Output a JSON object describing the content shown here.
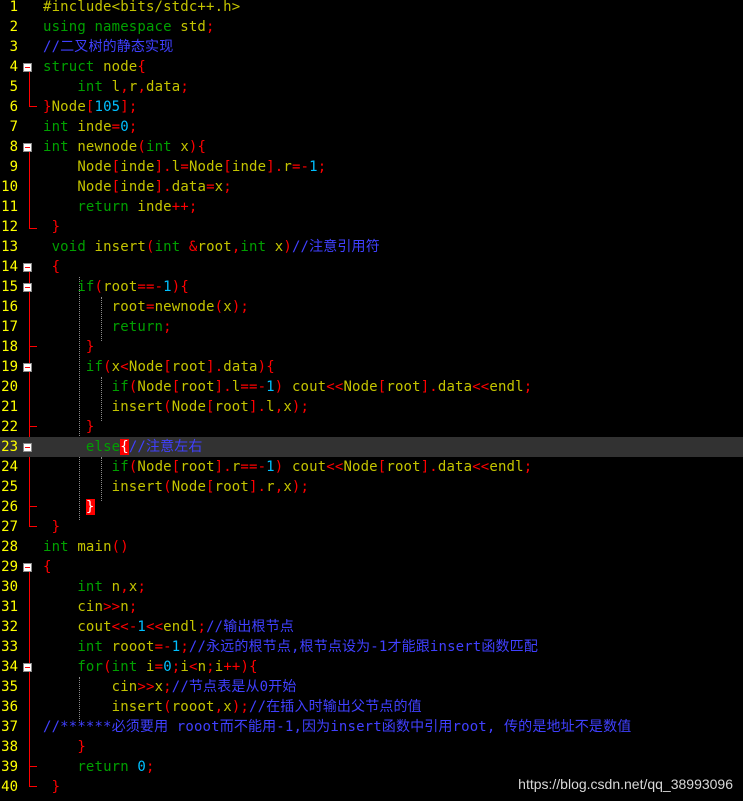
{
  "editor": {
    "current_line": 23,
    "lines": [
      {
        "n": "1",
        "tokens": [
          [
            "#include<bits/stdc++.h>",
            "#c4c400"
          ]
        ]
      },
      {
        "n": "2",
        "tokens": [
          [
            "using namespace ",
            "#00a000"
          ],
          [
            "std",
            "#c4c400"
          ],
          [
            ";",
            "#ff0000"
          ]
        ]
      },
      {
        "n": "3",
        "tokens": [
          [
            "//二叉树的静态实现",
            "#4040ff"
          ]
        ]
      },
      {
        "n": "4",
        "fold": true,
        "tokens": [
          [
            "struct ",
            "#00a000"
          ],
          [
            "node",
            "#c4c400"
          ],
          [
            "{",
            "#ff0000"
          ]
        ]
      },
      {
        "n": "5",
        "tokens": [
          [
            "    ",
            "#ffffff"
          ],
          [
            "int ",
            "#00a000"
          ],
          [
            "l",
            "#c4c400"
          ],
          [
            ",",
            "#ff0000"
          ],
          [
            "r",
            "#c4c400"
          ],
          [
            ",",
            "#ff0000"
          ],
          [
            "data",
            "#c4c400"
          ],
          [
            ";",
            "#ff0000"
          ]
        ]
      },
      {
        "n": "6",
        "tokens": [
          [
            "}",
            "#ff0000"
          ],
          [
            "Node",
            "#c4c400"
          ],
          [
            "[",
            "#ff0000"
          ],
          [
            "105",
            "#00c0ff"
          ],
          [
            "];",
            "#ff0000"
          ]
        ]
      },
      {
        "n": "7",
        "tokens": [
          [
            "int ",
            "#00a000"
          ],
          [
            "inde",
            "#c4c400"
          ],
          [
            "=",
            "#ff0000"
          ],
          [
            "0",
            "#00c0ff"
          ],
          [
            ";",
            "#ff0000"
          ]
        ]
      },
      {
        "n": "8",
        "fold": true,
        "tokens": [
          [
            "int ",
            "#00a000"
          ],
          [
            "newnode",
            "#c4c400"
          ],
          [
            "(",
            "#ff0000"
          ],
          [
            "int ",
            "#00a000"
          ],
          [
            "x",
            "#c4c400"
          ],
          [
            "){",
            "#ff0000"
          ]
        ]
      },
      {
        "n": "9",
        "tokens": [
          [
            "    ",
            "#ffffff"
          ],
          [
            "Node",
            "#c4c400"
          ],
          [
            "[",
            "#ff0000"
          ],
          [
            "inde",
            "#c4c400"
          ],
          [
            "].",
            "#ff0000"
          ],
          [
            "l",
            "#c4c400"
          ],
          [
            "=",
            "#ff0000"
          ],
          [
            "Node",
            "#c4c400"
          ],
          [
            "[",
            "#ff0000"
          ],
          [
            "inde",
            "#c4c400"
          ],
          [
            "].",
            "#ff0000"
          ],
          [
            "r",
            "#c4c400"
          ],
          [
            "=-",
            "#ff0000"
          ],
          [
            "1",
            "#00c0ff"
          ],
          [
            ";",
            "#ff0000"
          ]
        ]
      },
      {
        "n": "10",
        "tokens": [
          [
            "    ",
            "#ffffff"
          ],
          [
            "Node",
            "#c4c400"
          ],
          [
            "[",
            "#ff0000"
          ],
          [
            "inde",
            "#c4c400"
          ],
          [
            "].",
            "#ff0000"
          ],
          [
            "data",
            "#c4c400"
          ],
          [
            "=",
            "#ff0000"
          ],
          [
            "x",
            "#c4c400"
          ],
          [
            ";",
            "#ff0000"
          ]
        ]
      },
      {
        "n": "11",
        "tokens": [
          [
            "    ",
            "#ffffff"
          ],
          [
            "return ",
            "#00a000"
          ],
          [
            "inde",
            "#c4c400"
          ],
          [
            "++;",
            "#ff0000"
          ]
        ]
      },
      {
        "n": "12",
        "tokens": [
          [
            " }",
            "#ff0000"
          ]
        ]
      },
      {
        "n": "13",
        "tokens": [
          [
            " ",
            "#ffffff"
          ],
          [
            "void ",
            "#00a000"
          ],
          [
            "insert",
            "#c4c400"
          ],
          [
            "(",
            "#ff0000"
          ],
          [
            "int ",
            "#00a000"
          ],
          [
            "&",
            "#ff0000"
          ],
          [
            "root",
            "#c4c400"
          ],
          [
            ",",
            "#ff0000"
          ],
          [
            "int ",
            "#00a000"
          ],
          [
            "x",
            "#c4c400"
          ],
          [
            ")",
            "#ff0000"
          ],
          [
            "//注意引用符",
            "#4040ff"
          ]
        ]
      },
      {
        "n": "14",
        "fold": true,
        "tokens": [
          [
            " {",
            "#ff0000"
          ]
        ]
      },
      {
        "n": "15",
        "fold": true,
        "tokens": [
          [
            "    ",
            "#ffffff"
          ],
          [
            "if",
            "#00a000"
          ],
          [
            "(",
            "#ff0000"
          ],
          [
            "root",
            "#c4c400"
          ],
          [
            "==-",
            "#ff0000"
          ],
          [
            "1",
            "#00c0ff"
          ],
          [
            "){",
            "#ff0000"
          ]
        ]
      },
      {
        "n": "16",
        "tokens": [
          [
            "        ",
            "#ffffff"
          ],
          [
            "root",
            "#c4c400"
          ],
          [
            "=",
            "#ff0000"
          ],
          [
            "newnode",
            "#c4c400"
          ],
          [
            "(",
            "#ff0000"
          ],
          [
            "x",
            "#c4c400"
          ],
          [
            ");",
            "#ff0000"
          ]
        ]
      },
      {
        "n": "17",
        "tokens": [
          [
            "        ",
            "#ffffff"
          ],
          [
            "return",
            "#00a000"
          ],
          [
            ";",
            "#ff0000"
          ]
        ]
      },
      {
        "n": "18",
        "tokens": [
          [
            "     }",
            "#ff0000"
          ]
        ]
      },
      {
        "n": "19",
        "fold": true,
        "tokens": [
          [
            "     ",
            "#ffffff"
          ],
          [
            "if",
            "#00a000"
          ],
          [
            "(",
            "#ff0000"
          ],
          [
            "x",
            "#c4c400"
          ],
          [
            "<",
            "#ff0000"
          ],
          [
            "Node",
            "#c4c400"
          ],
          [
            "[",
            "#ff0000"
          ],
          [
            "root",
            "#c4c400"
          ],
          [
            "].",
            "#ff0000"
          ],
          [
            "data",
            "#c4c400"
          ],
          [
            "){",
            "#ff0000"
          ]
        ]
      },
      {
        "n": "20",
        "tokens": [
          [
            "        ",
            "#ffffff"
          ],
          [
            "if",
            "#00a000"
          ],
          [
            "(",
            "#ff0000"
          ],
          [
            "Node",
            "#c4c400"
          ],
          [
            "[",
            "#ff0000"
          ],
          [
            "root",
            "#c4c400"
          ],
          [
            "].",
            "#ff0000"
          ],
          [
            "l",
            "#c4c400"
          ],
          [
            "==-",
            "#ff0000"
          ],
          [
            "1",
            "#00c0ff"
          ],
          [
            ") ",
            "#ff0000"
          ],
          [
            "cout",
            "#c4c400"
          ],
          [
            "<<",
            "#ff0000"
          ],
          [
            "Node",
            "#c4c400"
          ],
          [
            "[",
            "#ff0000"
          ],
          [
            "root",
            "#c4c400"
          ],
          [
            "].",
            "#ff0000"
          ],
          [
            "data",
            "#c4c400"
          ],
          [
            "<<",
            "#ff0000"
          ],
          [
            "endl",
            "#c4c400"
          ],
          [
            ";",
            "#ff0000"
          ]
        ]
      },
      {
        "n": "21",
        "tokens": [
          [
            "        ",
            "#ffffff"
          ],
          [
            "insert",
            "#c4c400"
          ],
          [
            "(",
            "#ff0000"
          ],
          [
            "Node",
            "#c4c400"
          ],
          [
            "[",
            "#ff0000"
          ],
          [
            "root",
            "#c4c400"
          ],
          [
            "].",
            "#ff0000"
          ],
          [
            "l",
            "#c4c400"
          ],
          [
            ",",
            "#ff0000"
          ],
          [
            "x",
            "#c4c400"
          ],
          [
            ");",
            "#ff0000"
          ]
        ]
      },
      {
        "n": "22",
        "tokens": [
          [
            "     }",
            "#ff0000"
          ]
        ]
      },
      {
        "n": "23",
        "fold": true,
        "tokens": [
          [
            "     ",
            "#ffffff"
          ],
          [
            "else",
            "#00a000"
          ],
          [
            "{",
            "#ffffff",
            "#ff0000"
          ],
          [
            "//注意左右",
            "#4040ff"
          ]
        ]
      },
      {
        "n": "24",
        "tokens": [
          [
            "        ",
            "#ffffff"
          ],
          [
            "if",
            "#00a000"
          ],
          [
            "(",
            "#ff0000"
          ],
          [
            "Node",
            "#c4c400"
          ],
          [
            "[",
            "#ff0000"
          ],
          [
            "root",
            "#c4c400"
          ],
          [
            "].",
            "#ff0000"
          ],
          [
            "r",
            "#c4c400"
          ],
          [
            "==-",
            "#ff0000"
          ],
          [
            "1",
            "#00c0ff"
          ],
          [
            ") ",
            "#ff0000"
          ],
          [
            "cout",
            "#c4c400"
          ],
          [
            "<<",
            "#ff0000"
          ],
          [
            "Node",
            "#c4c400"
          ],
          [
            "[",
            "#ff0000"
          ],
          [
            "root",
            "#c4c400"
          ],
          [
            "].",
            "#ff0000"
          ],
          [
            "data",
            "#c4c400"
          ],
          [
            "<<",
            "#ff0000"
          ],
          [
            "endl",
            "#c4c400"
          ],
          [
            ";",
            "#ff0000"
          ]
        ]
      },
      {
        "n": "25",
        "tokens": [
          [
            "        ",
            "#ffffff"
          ],
          [
            "insert",
            "#c4c400"
          ],
          [
            "(",
            "#ff0000"
          ],
          [
            "Node",
            "#c4c400"
          ],
          [
            "[",
            "#ff0000"
          ],
          [
            "root",
            "#c4c400"
          ],
          [
            "].",
            "#ff0000"
          ],
          [
            "r",
            "#c4c400"
          ],
          [
            ",",
            "#ff0000"
          ],
          [
            "x",
            "#c4c400"
          ],
          [
            ");",
            "#ff0000"
          ]
        ]
      },
      {
        "n": "26",
        "tokens": [
          [
            "     ",
            "#ffffff"
          ],
          [
            "}",
            "#ffffff",
            "#ff0000"
          ]
        ]
      },
      {
        "n": "27",
        "tokens": [
          [
            " }",
            "#ff0000"
          ]
        ]
      },
      {
        "n": "28",
        "tokens": [
          [
            "int ",
            "#00a000"
          ],
          [
            "main",
            "#c4c400"
          ],
          [
            "()",
            "#ff0000"
          ]
        ]
      },
      {
        "n": "29",
        "fold": true,
        "tokens": [
          [
            "{",
            "#ff0000"
          ]
        ]
      },
      {
        "n": "30",
        "tokens": [
          [
            "    ",
            "#ffffff"
          ],
          [
            "int ",
            "#00a000"
          ],
          [
            "n",
            "#c4c400"
          ],
          [
            ",",
            "#ff0000"
          ],
          [
            "x",
            "#c4c400"
          ],
          [
            ";",
            "#ff0000"
          ]
        ]
      },
      {
        "n": "31",
        "tokens": [
          [
            "    ",
            "#ffffff"
          ],
          [
            "cin",
            "#c4c400"
          ],
          [
            ">>",
            "#ff0000"
          ],
          [
            "n",
            "#c4c400"
          ],
          [
            ";",
            "#ff0000"
          ]
        ]
      },
      {
        "n": "32",
        "tokens": [
          [
            "    ",
            "#ffffff"
          ],
          [
            "cout",
            "#c4c400"
          ],
          [
            "<<-",
            "#ff0000"
          ],
          [
            "1",
            "#00c0ff"
          ],
          [
            "<<",
            "#ff0000"
          ],
          [
            "endl",
            "#c4c400"
          ],
          [
            ";",
            "#ff0000"
          ],
          [
            "//输出根节点",
            "#4040ff"
          ]
        ]
      },
      {
        "n": "33",
        "tokens": [
          [
            "    ",
            "#ffffff"
          ],
          [
            "int ",
            "#00a000"
          ],
          [
            "rooot",
            "#c4c400"
          ],
          [
            "=-",
            "#ff0000"
          ],
          [
            "1",
            "#00c0ff"
          ],
          [
            ";",
            "#ff0000"
          ],
          [
            "//永远的根节点,根节点设为-1才能跟insert函数匹配",
            "#4040ff"
          ]
        ]
      },
      {
        "n": "34",
        "fold": true,
        "tokens": [
          [
            "    ",
            "#ffffff"
          ],
          [
            "for",
            "#00a000"
          ],
          [
            "(",
            "#ff0000"
          ],
          [
            "int ",
            "#00a000"
          ],
          [
            "i",
            "#c4c400"
          ],
          [
            "=",
            "#ff0000"
          ],
          [
            "0",
            "#00c0ff"
          ],
          [
            ";",
            "#ff0000"
          ],
          [
            "i",
            "#c4c400"
          ],
          [
            "<",
            "#ff0000"
          ],
          [
            "n",
            "#c4c400"
          ],
          [
            ";",
            "#ff0000"
          ],
          [
            "i",
            "#c4c400"
          ],
          [
            "++){",
            "#ff0000"
          ]
        ]
      },
      {
        "n": "35",
        "tokens": [
          [
            "        ",
            "#ffffff"
          ],
          [
            "cin",
            "#c4c400"
          ],
          [
            ">>",
            "#ff0000"
          ],
          [
            "x",
            "#c4c400"
          ],
          [
            ";",
            "#ff0000"
          ],
          [
            "//节点表是从0开始",
            "#4040ff"
          ]
        ]
      },
      {
        "n": "36",
        "tokens": [
          [
            "        ",
            "#ffffff"
          ],
          [
            "insert",
            "#c4c400"
          ],
          [
            "(",
            "#ff0000"
          ],
          [
            "rooot",
            "#c4c400"
          ],
          [
            ",",
            "#ff0000"
          ],
          [
            "x",
            "#c4c400"
          ],
          [
            ");",
            "#ff0000"
          ],
          [
            "//在插入时输出父节点的值",
            "#4040ff"
          ]
        ]
      },
      {
        "n": "37",
        "tokens": [
          [
            "//******必须要用 rooot而不能用-1,因为insert函数中引用root, 传的是地址不是数值",
            "#4040ff"
          ]
        ]
      },
      {
        "n": "38",
        "tokens": [
          [
            "    }",
            "#ff0000"
          ]
        ]
      },
      {
        "n": "39",
        "tokens": [
          [
            "    ",
            "#ffffff"
          ],
          [
            "return ",
            "#00a000"
          ],
          [
            "0",
            "#00c0ff"
          ],
          [
            ";",
            "#ff0000"
          ]
        ]
      },
      {
        "n": "40",
        "tokens": [
          [
            " }",
            "#ff0000"
          ]
        ]
      }
    ]
  },
  "watermark": "https://blog.csdn.net/qq_38993096"
}
